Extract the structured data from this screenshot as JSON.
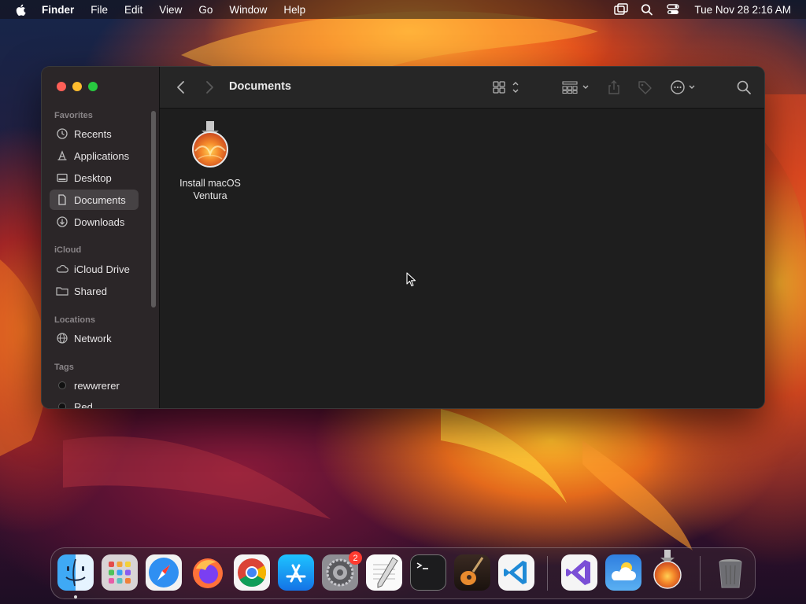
{
  "menubar": {
    "app_name": "Finder",
    "menus": [
      "File",
      "Edit",
      "View",
      "Go",
      "Window",
      "Help"
    ],
    "clock": "Tue Nov 28  2:16 AM",
    "status_icons": [
      "screen-mirroring-icon",
      "spotlight-search-icon",
      "control-center-icon"
    ]
  },
  "finder": {
    "title": "Documents",
    "sidebar": {
      "favorites_header": "Favorites",
      "favorites": [
        {
          "label": "Recents",
          "icon": "clock-icon"
        },
        {
          "label": "Applications",
          "icon": "applications-icon"
        },
        {
          "label": "Desktop",
          "icon": "desktop-icon"
        },
        {
          "label": "Documents",
          "icon": "document-icon",
          "selected": true
        },
        {
          "label": "Downloads",
          "icon": "download-icon"
        }
      ],
      "icloud_header": "iCloud",
      "icloud": [
        {
          "label": "iCloud Drive",
          "icon": "cloud-icon"
        },
        {
          "label": "Shared",
          "icon": "shared-folder-icon"
        }
      ],
      "locations_header": "Locations",
      "locations": [
        {
          "label": "Network",
          "icon": "globe-icon"
        }
      ],
      "tags_header": "Tags",
      "tags": [
        {
          "label": "rewwrerer",
          "color": "#111111"
        },
        {
          "label": "Red",
          "color": "#111111"
        }
      ]
    },
    "files": [
      {
        "name": "Install macOS Ventura",
        "icon": "macos-installer-icon"
      }
    ]
  },
  "dock": {
    "apps": [
      {
        "name": "Finder",
        "icon": "finder-icon",
        "running": true
      },
      {
        "name": "Launchpad",
        "icon": "launchpad-icon"
      },
      {
        "name": "Safari",
        "icon": "safari-icon"
      },
      {
        "name": "Firefox",
        "icon": "firefox-icon"
      },
      {
        "name": "Chrome",
        "icon": "chrome-icon"
      },
      {
        "name": "App Store",
        "icon": "app-store-icon"
      },
      {
        "name": "System Settings",
        "icon": "settings-icon",
        "badge": "2"
      },
      {
        "name": "TextEdit",
        "icon": "textedit-icon"
      },
      {
        "name": "Terminal",
        "icon": "terminal-icon"
      },
      {
        "name": "GarageBand",
        "icon": "garageband-icon"
      },
      {
        "name": "Visual Studio Code",
        "icon": "vscode-icon"
      },
      {
        "name": "Visual Studio",
        "icon": "visual-studio-icon"
      },
      {
        "name": "Weather",
        "icon": "weather-icon"
      },
      {
        "name": "Install macOS Ventura",
        "icon": "macos-installer-icon"
      },
      {
        "name": "Trash",
        "icon": "trash-icon"
      }
    ]
  }
}
